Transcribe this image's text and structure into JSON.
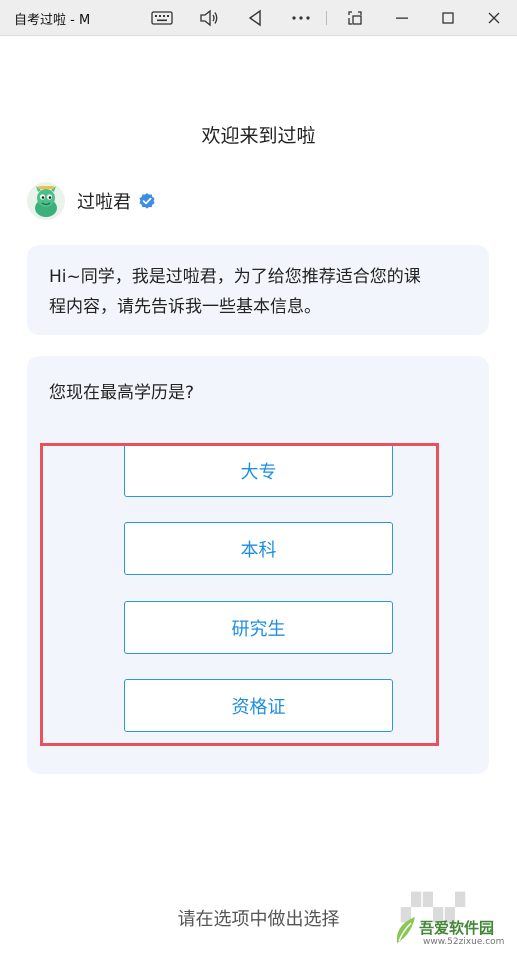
{
  "window": {
    "title": "自考过啦 - M",
    "toolbar_icons": [
      "keyboard-icon",
      "volume-icon",
      "back-icon",
      "more-icon",
      "screenshot-icon",
      "minimize-icon",
      "maximize-icon",
      "close-icon"
    ]
  },
  "header": {
    "title": "欢迎来到过啦"
  },
  "bot": {
    "name": "过啦君",
    "verified": true
  },
  "message": {
    "line1": "Hi~同学，我是过啦君，为了给您推荐适合您的课",
    "line2": "程内容，请先告诉我一些基本信息。"
  },
  "question": {
    "text": "您现在最高学历是?",
    "options": [
      "大专",
      "本科",
      "研究生",
      "资格证"
    ]
  },
  "footer": {
    "prompt": "请在选项中做出选择"
  },
  "watermark": {
    "site_name": "吾爱软件园",
    "url": "www.52zixue.com"
  },
  "colors": {
    "option_border": "#2a97e6",
    "option_text": "#1e8ee0",
    "highlight_border": "#e8535b",
    "card_background": "#f2f6fc"
  }
}
